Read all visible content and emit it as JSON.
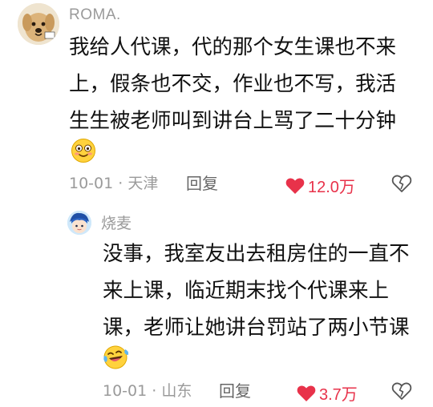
{
  "comment": {
    "username": "ROMA.",
    "lines": [
      "我给人代课，代的那个女生课也不来",
      "上，假条也不交，作业也不写，我活",
      "生生被老师叫到讲台上骂了二十分钟"
    ],
    "emoji": "smiling-face-emoji",
    "date": "10-01",
    "separator": "·",
    "location": "天津",
    "reply_label": "回复",
    "likes": "12.0万",
    "like_color": "#e8324a"
  },
  "reply": {
    "username": "烧麦",
    "lines": [
      "没事，我室友出去租房住的一直不",
      "来上课，临近期末找个代课来上",
      "课，老师让她讲台罚站了两小节课"
    ],
    "emoji": "laughing-tears-emoji",
    "date": "10-01",
    "separator": "·",
    "location": "山东",
    "reply_label": "回复",
    "likes": "3.7万"
  }
}
